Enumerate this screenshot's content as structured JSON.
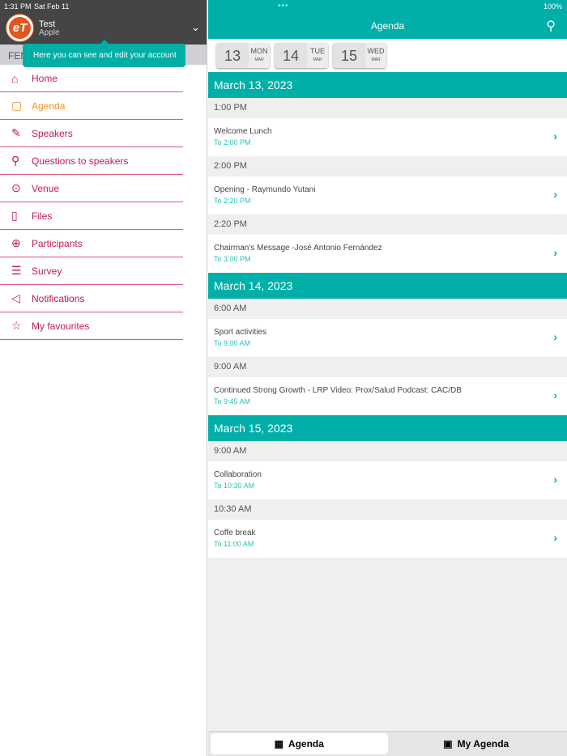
{
  "status": {
    "time": "1:31 PM",
    "date": "Sat Feb 11",
    "battery": "100%"
  },
  "account": {
    "logo_text": "eT",
    "name": "Test",
    "org": "Apple",
    "band": "FEM"
  },
  "tooltip": "Here you can see and edit your account",
  "menu": [
    {
      "label": "Home",
      "icon": "⌂"
    },
    {
      "label": "Agenda",
      "icon": "▢"
    },
    {
      "label": "Speakers",
      "icon": "✎"
    },
    {
      "label": "Questions to speakers",
      "icon": "⚲"
    },
    {
      "label": "Venue",
      "icon": "⊙"
    },
    {
      "label": "Files",
      "icon": "▯"
    },
    {
      "label": "Participants",
      "icon": "⊕"
    },
    {
      "label": "Survey",
      "icon": "☰"
    },
    {
      "label": "Notifications",
      "icon": "◁"
    },
    {
      "label": "My favourites",
      "icon": "☆"
    }
  ],
  "menu_active": "Agenda",
  "header": {
    "title": "Agenda"
  },
  "dates": [
    {
      "day": "13",
      "weekday": "MON",
      "month": "MAR"
    },
    {
      "day": "14",
      "weekday": "TUE",
      "month": "MAR"
    },
    {
      "day": "15",
      "weekday": "WED",
      "month": "MAR"
    }
  ],
  "agenda": [
    {
      "date": "March 13, 2023",
      "slots": [
        {
          "time": "1:00 PM",
          "title": "Welcome Lunch",
          "end": "To 2:00 PM"
        },
        {
          "time": "2:00 PM",
          "title": "Opening - Raymundo Yutani",
          "end": "To 2:20 PM"
        },
        {
          "time": "2:20 PM",
          "title": "Chairman's Message -José Antonio Fernández",
          "end": "To 3:00 PM"
        }
      ]
    },
    {
      "date": "March 14, 2023",
      "slots": [
        {
          "time": "6:00 AM",
          "title": "Sport activities",
          "end": "To 9:00 AM"
        },
        {
          "time": "9:00 AM",
          "title": "Continued Strong Growth - LRP Video: Prox/Salud Podcast: CAC/DB",
          "end": "To 9:45 AM"
        }
      ]
    },
    {
      "date": "March 15, 2023",
      "slots": [
        {
          "time": "9:00 AM",
          "title": "Collaboration",
          "end": "To 10:30 AM"
        },
        {
          "time": "10:30 AM",
          "title": "Coffe break",
          "end": "To 11:00 AM"
        }
      ]
    }
  ],
  "bottom_tabs": [
    {
      "label": "Agenda",
      "active": true
    },
    {
      "label": "My Agenda",
      "active": false
    }
  ],
  "colors": {
    "teal": "#00afa8",
    "menu": "#c2185b",
    "active": "#f5901e"
  }
}
